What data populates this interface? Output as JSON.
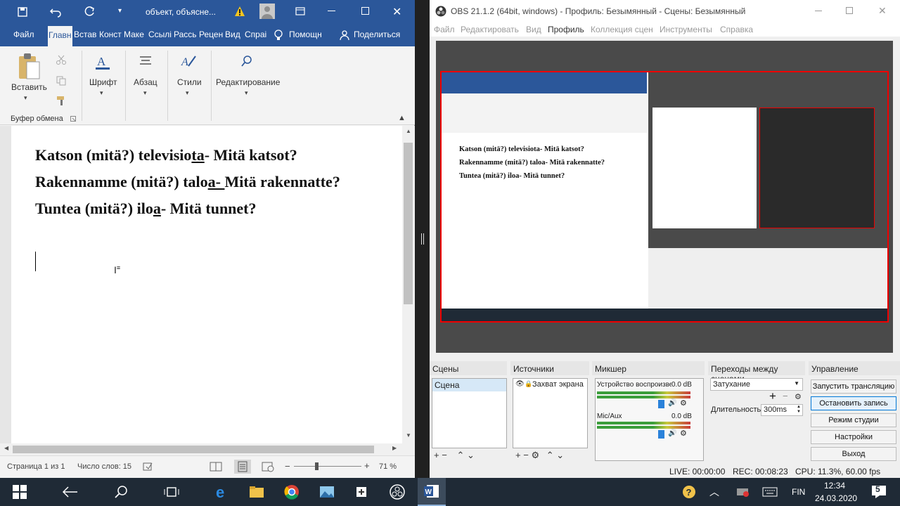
{
  "word": {
    "title": "объект, объясне...",
    "tabs": [
      "Файл",
      "Главн",
      "Встав",
      "Конст",
      "Маке",
      "Ссылі",
      "Рассь",
      "Рецен",
      "Вид",
      "Спраі"
    ],
    "tell_me": "Помощн",
    "share": "Поделиться",
    "ribbon": {
      "paste": "Вставить",
      "font": "Шрифт",
      "paragraph": "Абзац",
      "styles": "Стили",
      "editing": "Редактирование",
      "clipboard_group": "Буфер обмена"
    },
    "doc": {
      "line1_a": "Katson (mitä?) televisio",
      "line1_u": "ta",
      "line1_b": "- Mitä katsot?",
      "line2_a": "Rakennamme (mitä?) talo",
      "line2_u": "a- ",
      "line2_b": "Mitä rakennatte?",
      "line3_a": "Tuntea (mitä?) ilo",
      "line3_u": "a",
      "line3_b": "- Mitä tunnet?"
    },
    "status": {
      "page": "Страница 1 из 1",
      "words": "Число слов: 15",
      "zoom": "71 %"
    }
  },
  "obs": {
    "title": "OBS 21.1.2 (64bit, windows) - Профиль: Безымянный - Сцены: Безымянный",
    "menu": [
      "Файл",
      "Редактировать",
      "Вид",
      "Профиль",
      "Коллекция сцен",
      "Инструменты",
      "Справка"
    ],
    "docks": {
      "scenes": "Сцены",
      "sources": "Источники",
      "mixer": "Микшер",
      "transitions": "Переходы между сценами",
      "controls": "Управление"
    },
    "scene_item": "Сцена",
    "source_item": "Захват экрана",
    "mixer": {
      "ch1_name": "Устройство воспроизве",
      "ch1_db": "0.0 dB",
      "ch2_name": "Mic/Aux",
      "ch2_db": "0.0 dB"
    },
    "transition": {
      "type": "Затухание",
      "duration_label": "Длительность",
      "duration": "300ms"
    },
    "controls": [
      "Запустить трансляцию",
      "Остановить запись",
      "Режим студии",
      "Настройки",
      "Выход"
    ],
    "status": {
      "live": "LIVE: 00:00:00",
      "rec": "REC: 00:08:23",
      "cpu": "CPU: 11.3%, 60.00 fps"
    },
    "preview": {
      "line1": "Katson (mitä?) televisiota- Mitä katsot?",
      "line2": "Rakennamme (mitä?) taloa- Mitä rakennatte?",
      "line3": "Tuntea (mitä?) iloa- Mitä tunnet?"
    }
  },
  "taskbar": {
    "lang": "FIN",
    "time": "12:34",
    "date": "24.03.2020",
    "notifications": "5"
  }
}
